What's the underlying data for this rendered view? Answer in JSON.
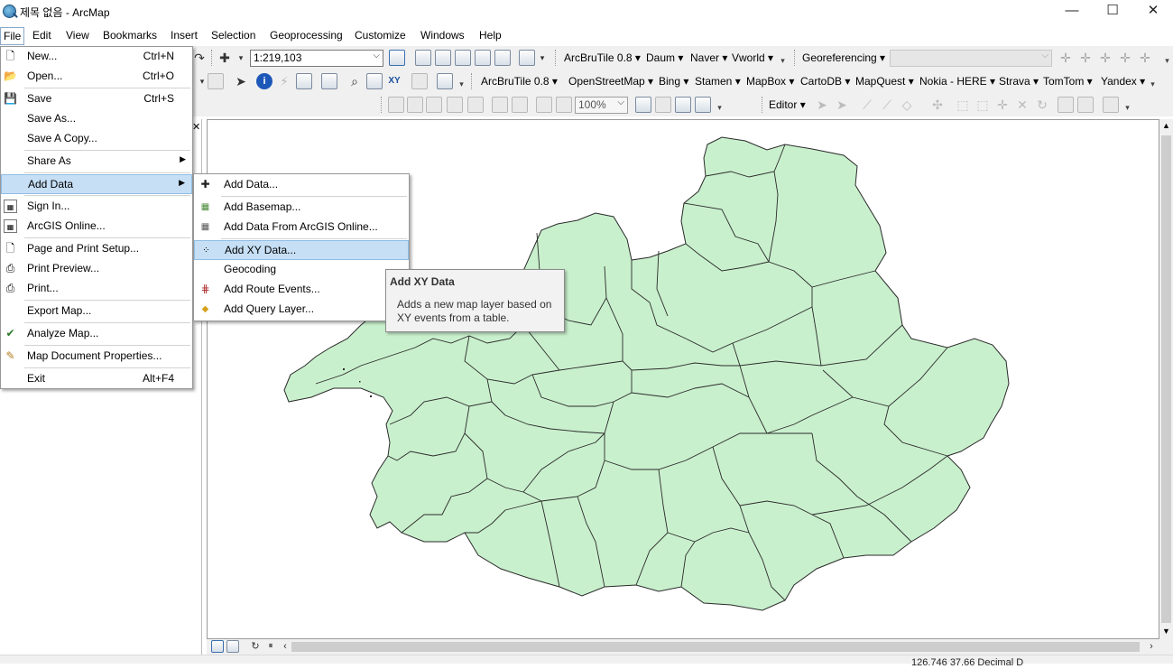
{
  "window": {
    "title": "제목 없음 - ArcMap",
    "buttons": {
      "minimize": "—",
      "maximize": "☐",
      "close": "✕"
    }
  },
  "menubar": [
    "File",
    "Edit",
    "View",
    "Bookmarks",
    "Insert",
    "Selection",
    "Geoprocessing",
    "Customize",
    "Windows",
    "Help"
  ],
  "toolbar1": {
    "scale": "1:219,103",
    "plugin_menus": [
      "ArcBruTile 0.8",
      "Daum",
      "Naver",
      "Vworld"
    ],
    "georeferencing": "Georeferencing"
  },
  "toolbar2": {
    "plugin_menus": [
      "ArcBruTile 0.8",
      "OpenStreetMap",
      "Bing",
      "Stamen",
      "MapBox",
      "CartoDB",
      "MapQuest",
      "Nokia - HERE",
      "Strava",
      "TomTom",
      "Yandex"
    ]
  },
  "toolbar3": {
    "zoom": "100%",
    "editor": "Editor"
  },
  "file_menu": [
    {
      "label": "New...",
      "shortcut": "Ctrl+N",
      "icon": "new-document-icon"
    },
    {
      "label": "Open...",
      "shortcut": "Ctrl+O",
      "icon": "open-folder-icon"
    },
    {
      "label": "Save",
      "shortcut": "Ctrl+S",
      "icon": "save-disk-icon"
    },
    {
      "label": "Save As...",
      "shortcut": "",
      "icon": ""
    },
    {
      "label": "Save A Copy...",
      "shortcut": "",
      "icon": ""
    },
    {
      "label": "Share As",
      "shortcut": "",
      "icon": ""
    },
    {
      "label": "Add Data",
      "shortcut": "",
      "icon": ""
    },
    {
      "label": "Sign In...",
      "shortcut": "",
      "icon": "sign-in-icon"
    },
    {
      "label": "ArcGIS Online...",
      "shortcut": "",
      "icon": "arcgis-online-icon"
    },
    {
      "label": "Page and Print Setup...",
      "shortcut": "",
      "icon": "page-setup-icon"
    },
    {
      "label": "Print Preview...",
      "shortcut": "",
      "icon": "print-preview-icon"
    },
    {
      "label": "Print...",
      "shortcut": "",
      "icon": "printer-icon"
    },
    {
      "label": "Export Map...",
      "shortcut": "",
      "icon": ""
    },
    {
      "label": "Analyze Map...",
      "shortcut": "",
      "icon": "analyze-map-icon"
    },
    {
      "label": "Map Document Properties...",
      "shortcut": "",
      "icon": "map-properties-icon"
    },
    {
      "label": "Exit",
      "shortcut": "Alt+F4",
      "icon": ""
    }
  ],
  "add_data_submenu": [
    {
      "label": "Add Data...",
      "icon": "add-data-icon"
    },
    {
      "label": "Add Basemap...",
      "icon": "basemap-icon"
    },
    {
      "label": "Add Data From ArcGIS Online...",
      "icon": "arcgis-online-grid-icon"
    },
    {
      "label": "Add XY Data...",
      "icon": "xy-data-icon"
    },
    {
      "label": "Geocoding",
      "icon": ""
    },
    {
      "label": "Add Route Events...",
      "icon": "route-events-icon"
    },
    {
      "label": "Add Query Layer...",
      "icon": "sql-query-icon"
    }
  ],
  "tooltip": {
    "title": "Add XY Data",
    "body": "Adds a new map layer based on XY events from a table."
  },
  "map": {
    "fill": "#c9f0cd",
    "stroke": "#2a2a2a"
  },
  "status": {
    "coords": "126.746 37.66 Decimal D"
  }
}
